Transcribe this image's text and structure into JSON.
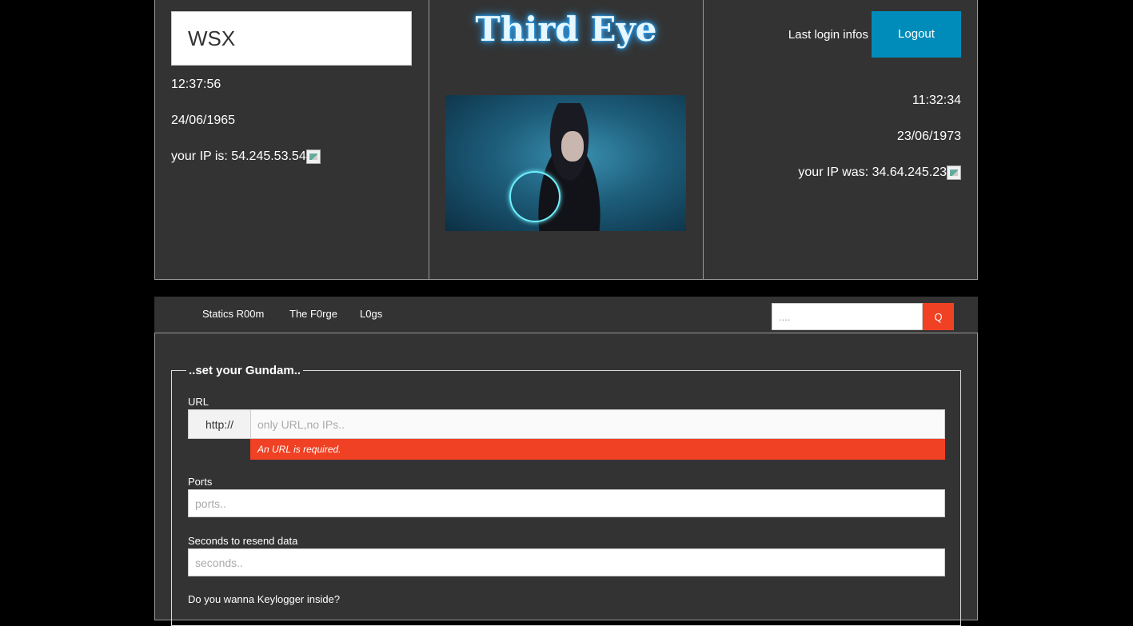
{
  "current": {
    "username": "WSX",
    "time": "12:37:56",
    "date": "24/06/1965",
    "ip_text": "your IP is: 54.245.53.54"
  },
  "header": {
    "title": "Third Eye"
  },
  "last_login": {
    "label": "Last login infos",
    "logout_label": "Logout",
    "time": "11:32:34",
    "date": "23/06/1973",
    "ip_text": "your IP was: 34.64.245.23"
  },
  "nav": {
    "items": [
      {
        "label": "Statics R00m"
      },
      {
        "label": "The F0rge"
      },
      {
        "label": "L0gs"
      }
    ],
    "search_placeholder": "....",
    "search_button": "Q"
  },
  "form": {
    "legend": "..set your Gundam..",
    "url_label": "URL",
    "url_prefix": "http://",
    "url_placeholder": "only URL,no IPs..",
    "url_error": "An URL is required.",
    "ports_label": "Ports",
    "ports_placeholder": "ports..",
    "seconds_label": "Seconds to resend data",
    "seconds_placeholder": "seconds..",
    "keylogger_label": "Do you wanna Keylogger inside?"
  },
  "colors": {
    "background": "#000000",
    "panel": "#333333",
    "accent_blue": "#008cba",
    "alert_red": "#f04124"
  }
}
